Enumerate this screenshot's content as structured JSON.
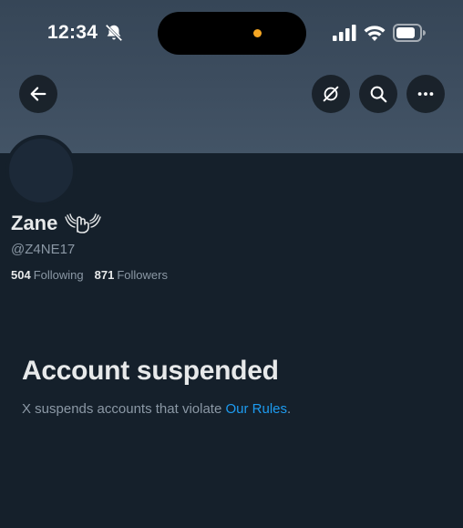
{
  "status_bar": {
    "time": "12:34",
    "bell_icon": "bell-slash-icon",
    "signal_icon": "cellular-signal-icon",
    "wifi_icon": "wifi-icon",
    "battery_icon": "battery-icon",
    "island_indicator_color": "#f5a623"
  },
  "header": {
    "back_icon": "arrow-left-icon",
    "grok_icon": "grok-icon",
    "search_icon": "search-icon",
    "more_icon": "more-horizontal-icon"
  },
  "profile": {
    "display_name": "Zane",
    "name_emoji": "winged-hand-emoji",
    "handle": "@Z4NE17",
    "following_count": "504",
    "following_label": "Following",
    "followers_count": "871",
    "followers_label": "Followers"
  },
  "suspended": {
    "title": "Account suspended",
    "text_before": "X suspends accounts that violate ",
    "link_text": "Our Rules",
    "text_after": "."
  },
  "colors": {
    "background": "#15202b",
    "banner": "#3d4d5f",
    "primary_text": "#e7e9ea",
    "secondary_text": "#8b98a5",
    "link": "#1d9bf0"
  }
}
